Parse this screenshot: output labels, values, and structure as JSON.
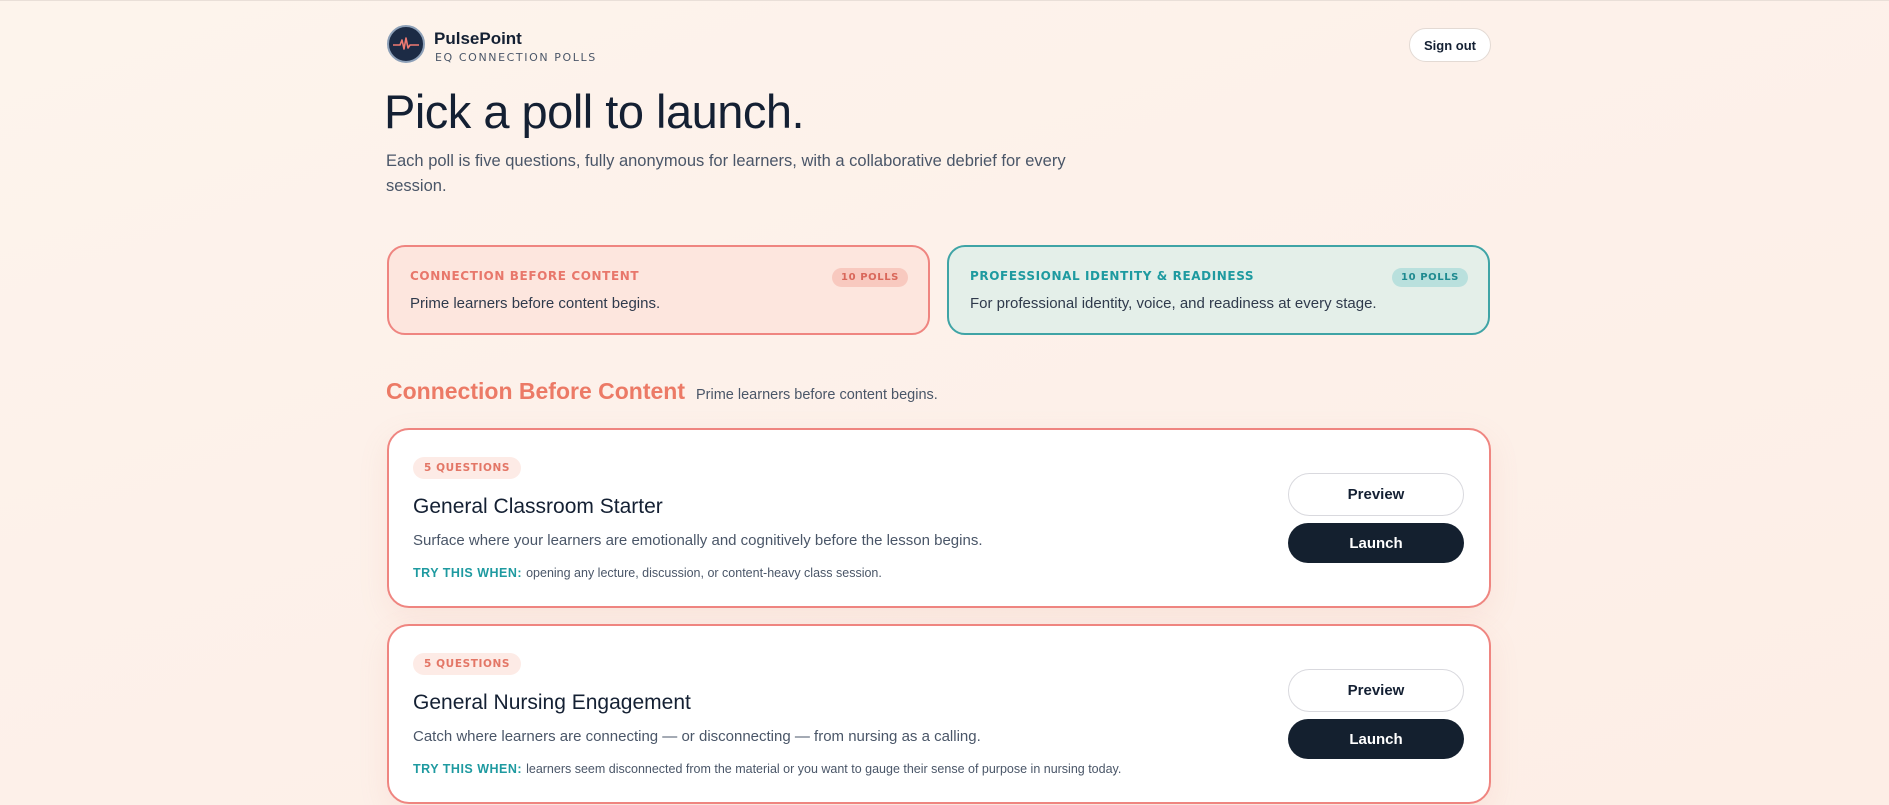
{
  "brand": {
    "name": "PulsePoint",
    "subtitle": "EQ CONNECTION POLLS"
  },
  "header": {
    "signout_label": "Sign out"
  },
  "hero": {
    "title": "Pick a poll to launch.",
    "subtitle": "Each poll is five questions, fully anonymous for learners, with a collaborative debrief for every session."
  },
  "categories": [
    {
      "label": "CONNECTION BEFORE CONTENT",
      "count": "10 POLLS",
      "description": "Prime learners before content begins.",
      "accent": "#ef8580"
    },
    {
      "label": "PROFESSIONAL IDENTITY & READINESS",
      "count": "10 POLLS",
      "description": "For professional identity, voice, and readiness at every stage.",
      "accent": "#3fa4a6"
    }
  ],
  "section": {
    "title": "Connection Before Content",
    "description": "Prime learners before content begins."
  },
  "polls": [
    {
      "badge": "5 QUESTIONS",
      "title": "General Classroom Starter",
      "description": "Surface where your learners are emotionally and cognitively before the lesson begins.",
      "try_label": "TRY THIS WHEN:",
      "try_text": "opening any lecture, discussion, or content-heavy class session.",
      "preview_label": "Preview",
      "launch_label": "Launch"
    },
    {
      "badge": "5 QUESTIONS",
      "title": "General Nursing Engagement",
      "description": "Catch where learners are connecting — or disconnecting — from nursing as a calling.",
      "try_label": "TRY THIS WHEN:",
      "try_text": "learners seem disconnected from the material or you want to gauge their sense of purpose in nursing today.",
      "preview_label": "Preview",
      "launch_label": "Launch"
    }
  ],
  "colors": {
    "accent_coral": "#ef8580",
    "accent_teal": "#1e9aa0",
    "dark": "#14202f"
  }
}
